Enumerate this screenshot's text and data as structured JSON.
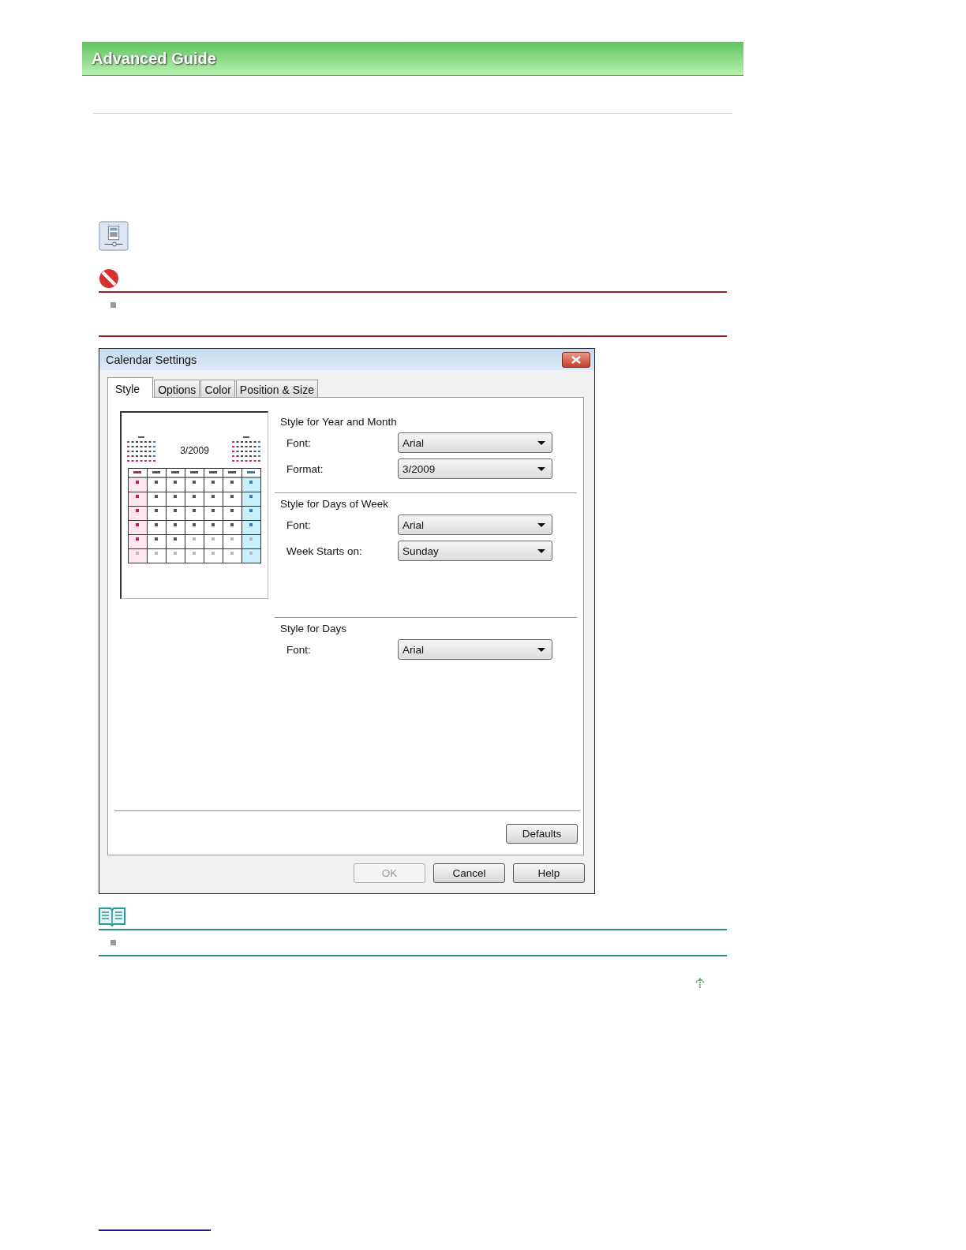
{
  "header": {
    "title": "Advanced Guide"
  },
  "dialog": {
    "title": "Calendar Settings",
    "tabs": [
      {
        "label": "Style",
        "selected": true
      },
      {
        "label": "Options",
        "selected": false
      },
      {
        "label": "Color",
        "selected": false
      },
      {
        "label": "Position & Size",
        "selected": false
      }
    ],
    "preview": {
      "title": "3/2009"
    },
    "groups": [
      {
        "title": "Style for Year and Month",
        "fields": [
          {
            "label": "Font:",
            "value": "Arial"
          },
          {
            "label": "Format:",
            "value": "3/2009"
          }
        ]
      },
      {
        "title": "Style for Days of Week",
        "fields": [
          {
            "label": "Font:",
            "value": "Arial"
          },
          {
            "label": "Week Starts on:",
            "value": "Sunday"
          }
        ]
      },
      {
        "title": "Style for Days",
        "fields": [
          {
            "label": "Font:",
            "value": "Arial"
          }
        ]
      }
    ],
    "defaults_button": {
      "label": "Defaults"
    },
    "buttons": [
      {
        "label": "OK",
        "disabled": true
      },
      {
        "label": "Cancel",
        "disabled": false
      },
      {
        "label": "Help",
        "disabled": false
      }
    ]
  }
}
